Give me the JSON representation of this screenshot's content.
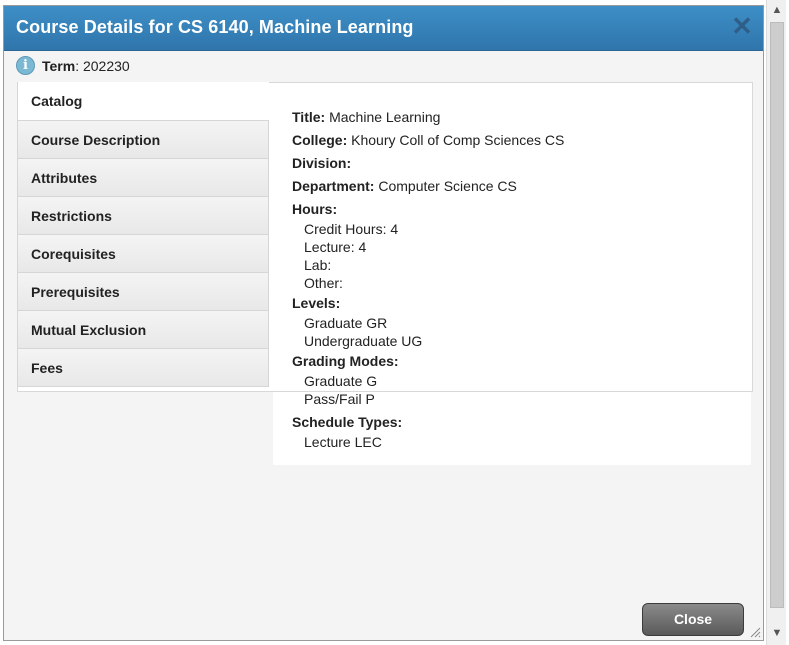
{
  "dialog": {
    "title": "Course Details for CS 6140, Machine Learning",
    "close_icon": "close-icon",
    "term_label": "Term",
    "term_value": ": 202230",
    "close_button_label": "Close"
  },
  "tabs": [
    {
      "label": "Catalog",
      "active": true
    },
    {
      "label": "Course Description"
    },
    {
      "label": "Attributes"
    },
    {
      "label": "Restrictions"
    },
    {
      "label": "Corequisites"
    },
    {
      "label": "Prerequisites"
    },
    {
      "label": "Mutual Exclusion"
    },
    {
      "label": "Fees"
    }
  ],
  "details": {
    "title_label": "Title:",
    "title_value": "Machine Learning",
    "college_label": "College:",
    "college_value": "Khoury Coll of Comp Sciences CS",
    "division_label": "Division:",
    "department_label": "Department:",
    "department_value": "Computer Science CS",
    "hours_label": "Hours:",
    "credit_hours": "Credit Hours: 4",
    "lecture": "Lecture: 4",
    "lab": "Lab:",
    "other": "Other:",
    "levels_label": "Levels:",
    "levels": [
      "Graduate GR",
      "Undergraduate UG"
    ],
    "grading_label": "Grading Modes:",
    "grading": [
      "Graduate G",
      "Pass/Fail P"
    ],
    "schedule_label": "Schedule Types:",
    "schedule": [
      "Lecture LEC"
    ]
  },
  "colors": {
    "titlebar": "#3d8fc6",
    "button": "#6a6a6a"
  }
}
